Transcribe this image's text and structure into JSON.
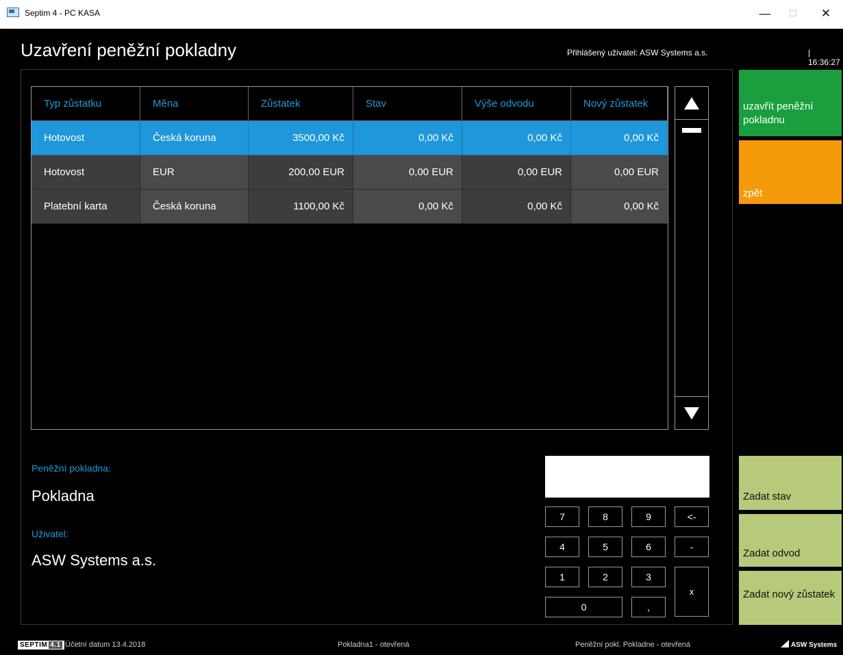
{
  "window": {
    "title": "Septim 4 - PC KASA",
    "minimize": "—",
    "maximize": "☐",
    "close": "✕"
  },
  "header": {
    "title": "Uzavření peněžní pokladny",
    "user": "Přihlášený uživatel: ASW Systems a.s.",
    "time": "| 16:36:27"
  },
  "table": {
    "columns": [
      "Typ zůstatku",
      "Měna",
      "Zůstatek",
      "Stav",
      "Výše odvodu",
      "Nový zůstatek"
    ],
    "rows": [
      [
        "Hotovost",
        "Česká koruna",
        "3500,00 Kč",
        "0,00 Kč",
        "0,00 Kč",
        "0,00 Kč"
      ],
      [
        "Hotovost",
        "EUR",
        "200,00 EUR",
        "0,00 EUR",
        "0,00 EUR",
        "0,00 EUR"
      ],
      [
        "Platební karta",
        "Česká koruna",
        "1100,00 Kč",
        "0,00 Kč",
        "0,00 Kč",
        "0,00 Kč"
      ]
    ],
    "selected_row": 0
  },
  "side_buttons": {
    "close_cash": "uzavřít peněžní pokladnu",
    "back": "zpět",
    "set_state": "Zadat stav",
    "set_transfer": "Zadat odvod",
    "set_new_balance": "Zadat nový zůstatek"
  },
  "info": {
    "cash_label": "Peněžní pokladna:",
    "cash_value": "Pokladna",
    "user_label": "Uživatel:",
    "user_value": "ASW Systems a.s."
  },
  "numpad": {
    "display_value": "",
    "keys": {
      "k7": "7",
      "k8": "8",
      "k9": "9",
      "back": "<-",
      "k4": "4",
      "k5": "5",
      "k6": "6",
      "minus": "-",
      "k1": "1",
      "k2": "2",
      "k3": "3",
      "clear": "x",
      "k0": "0",
      "comma": ","
    }
  },
  "status": {
    "logo": "SEPTIM",
    "logo_version": "4.1",
    "date": "Účetní datum 13.4.2018",
    "register": "Pokladna1 - otevřená",
    "cash_state": "Peněžní pokl. Pokladne - otevřená",
    "vendor": "ASW Systems"
  },
  "colors": {
    "accent_blue": "#1e97db",
    "green": "#1a9e3e",
    "orange": "#f59b0b",
    "olive": "#b7c97a"
  }
}
